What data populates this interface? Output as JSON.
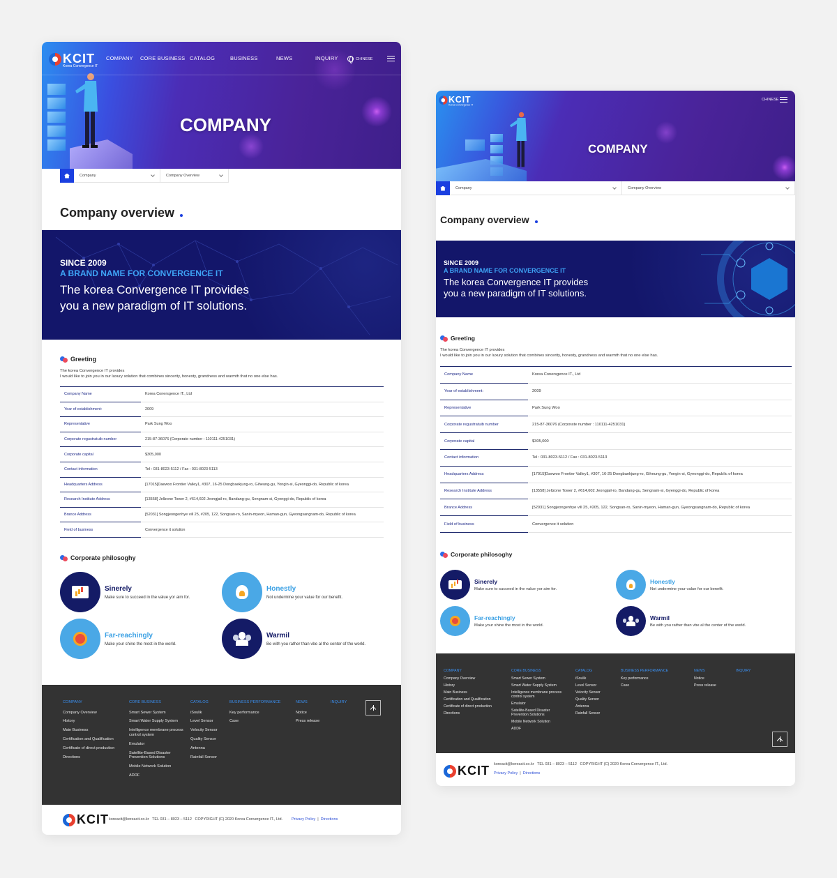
{
  "desktop": {
    "logo": {
      "text": "KCIT",
      "tagline": "Korea Convergence IT"
    },
    "nav": [
      "COMPANY",
      "CORE BUSINESS",
      "CATALOG",
      "BUSINESS",
      "NEWS",
      "INQUIRY"
    ],
    "lang": "CHINESE",
    "hero_title": "COMPANY",
    "breadcrumb": {
      "level1": "Company",
      "level2": "Company Overview"
    }
  },
  "page_title": "Company overview",
  "banner": {
    "since": "SINCE 2009",
    "brand": "A BRAND NAME FOR CONVERGENCE IT",
    "line1": "The korea Convergence IT provides",
    "line2": "you a new paradigm of IT solutions."
  },
  "greeting": {
    "title": "Greeting",
    "line1": "The korea Convergence IT provides",
    "line2": "I would like to join you in our luxury solution that combines sincerity, honesty, grandness and warmth that no one else has."
  },
  "info": [
    {
      "k": "Company Name",
      "v": "Korea Conersgence IT., Ltd"
    },
    {
      "k": "Year of establishment:",
      "v": "2009"
    },
    {
      "k": "Representative",
      "v": "Park Sung Woo"
    },
    {
      "k": "Corporate regustratuib number",
      "v": "215-87-36076 (Corporate number : 110111-4251031)"
    },
    {
      "k": "Corporate capital",
      "v": "$305,000"
    },
    {
      "k": "Contact information",
      "v": "Tel : 031-8023-5112 / Fax : 031-8023-5113"
    },
    {
      "k": "Headquarters Address",
      "v": "[17015]Daewoo Frontier Valley1, #307, 16-25 Dongbaekjung-ro, Giheung-gu, Yongin-si, Gyeonggi-do, Republic of korea"
    },
    {
      "k": "Research Institute Address",
      "v": "[13558] Jellzone Tower 2, #614,602 Jeongjail-ro, Bandang-gu, Sengnam-si, Gyenggi-do, Republic of korea"
    },
    {
      "k": "Brance Address",
      "v": "[52031] Songjeongenhye vill 25, #205, 122, Songsan-ro, Sanin-myeon, Haman-gun, Gyeongsangnam-do, Republic of korea"
    },
    {
      "k": "Field of business",
      "v": "Convergence it solution"
    }
  ],
  "philosophy": {
    "title": "Corporate philosoghy",
    "items": [
      {
        "title": "Sinerely",
        "desc": "Make sure to succeed in the value yor aim for.",
        "icon": "chart-monitor-icon",
        "color": "#141b66"
      },
      {
        "title": "Honestly",
        "desc": "Not undermine your value for our benefit.",
        "icon": "lightbulb-icon",
        "color": "#4aa8e6"
      },
      {
        "title": "Far-reachingly",
        "desc": "Make your shine the most in the world.",
        "icon": "medal-icon",
        "color": "#4aa8e6"
      },
      {
        "title": "Warmil",
        "desc": "Be with you rather than vbe al the center of the world.",
        "icon": "people-icon",
        "color": "#141b66"
      }
    ]
  },
  "footer": {
    "columns": [
      {
        "head": "COMPANY",
        "items": [
          "Company Overview",
          "History",
          "Main Business",
          "Certification and Qualification",
          "Certificate of direct production",
          "Directions"
        ]
      },
      {
        "head": "CORE BUSINESS",
        "items": [
          "Smart Sewer System",
          "Smart Water Supply System",
          "Intelligence membrane process control system",
          "Emulator",
          "Satellite-Based Disaster Prevention Solutions",
          "Mobile Network Solution",
          "ADDF"
        ]
      },
      {
        "head": "CATALOG",
        "items": [
          "iSoulik",
          "Level Sensor",
          "Velocity Sensor",
          "Quality Sensor",
          "Antenna",
          "Rainfall Sensor"
        ]
      },
      {
        "head": "BUSINESS PERFORMANCE",
        "items": [
          "Key performance",
          "Case"
        ]
      },
      {
        "head": "NEWS",
        "items": [
          "Notice",
          "Press release"
        ]
      },
      {
        "head": "INQUIRY",
        "items": []
      }
    ],
    "email": "koreacit@koreacit.co.kr",
    "tel": "TEL 031 – 8023 – 5112",
    "copyright": "COPYRIGHT (C) 2020 Korea Convergence IT., Ltd.",
    "privacy": "Privacy Policy",
    "directions": "Directions",
    "sep": "|"
  },
  "mobile": {
    "lang": "CHINESE",
    "hero_title": "COMPANY",
    "breadcrumb": {
      "level1": "Company",
      "level2": "Company Overview"
    }
  },
  "colors": {
    "accent": "#1a3fe0",
    "navy": "#13166a",
    "sky": "#3ea3f5",
    "footer": "#333333"
  }
}
